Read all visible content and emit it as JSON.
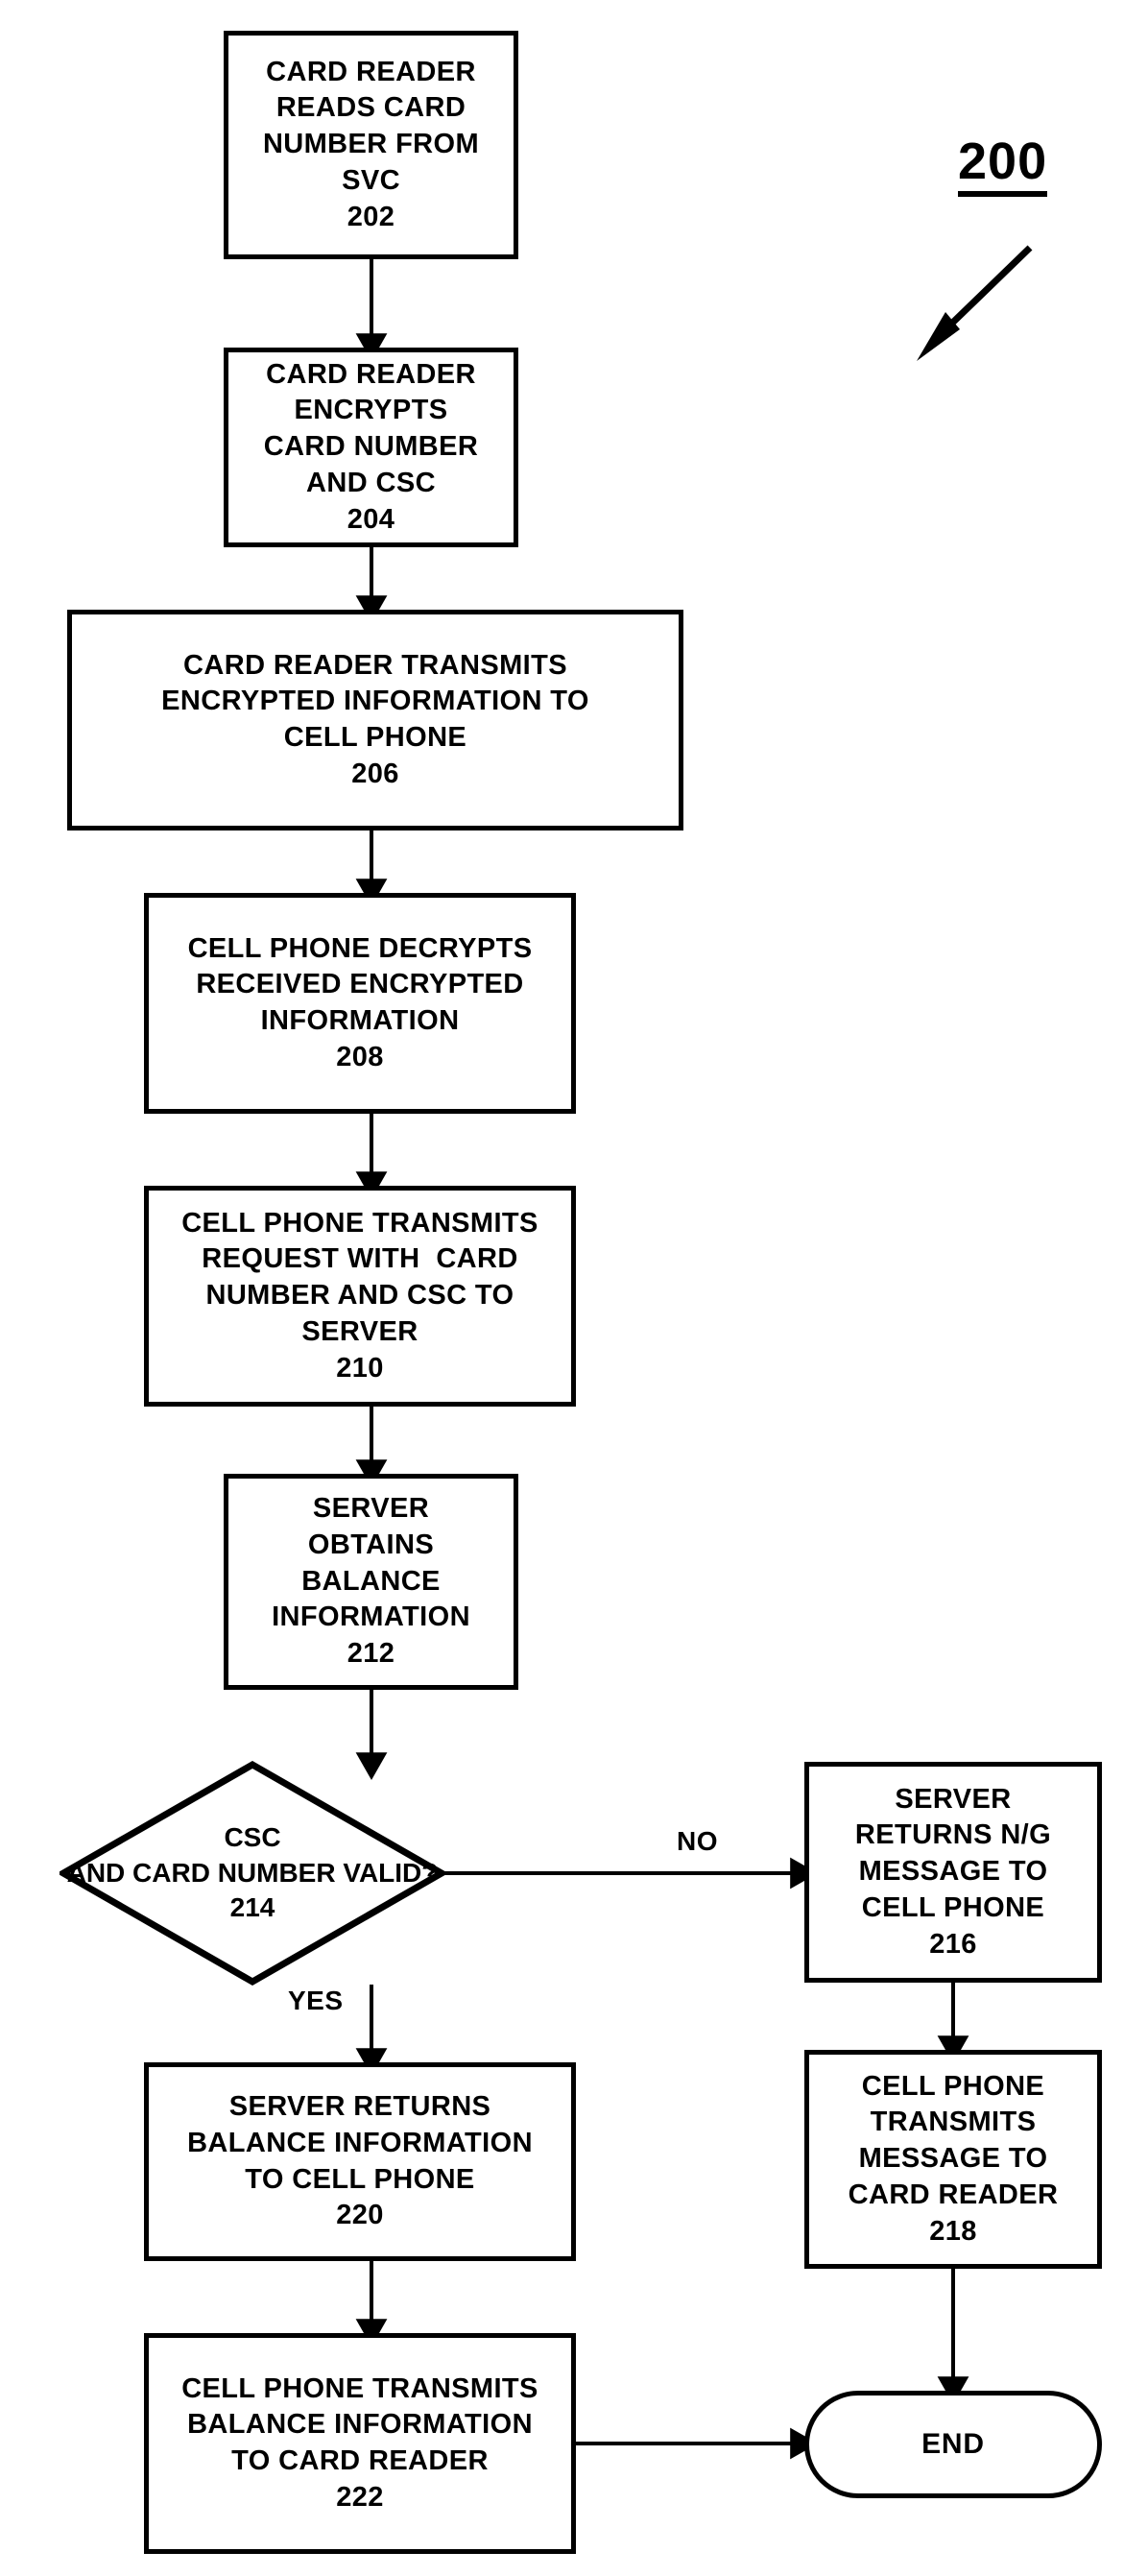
{
  "figure": {
    "number": "200",
    "type": "flowchart"
  },
  "nodes": {
    "n202": {
      "id": "202",
      "shape": "process",
      "lines": [
        "CARD READER",
        "READS CARD",
        "NUMBER FROM",
        "SVC",
        "202"
      ]
    },
    "n204": {
      "id": "204",
      "shape": "process",
      "lines": [
        "CARD READER",
        "ENCRYPTS",
        "CARD NUMBER",
        "AND CSC",
        "204"
      ]
    },
    "n206": {
      "id": "206",
      "shape": "process",
      "lines": [
        "CARD READER TRANSMITS",
        "ENCRYPTED INFORMATION TO",
        "CELL PHONE",
        "206"
      ]
    },
    "n208": {
      "id": "208",
      "shape": "process",
      "lines": [
        "CELL PHONE DECRYPTS",
        "RECEIVED ENCRYPTED",
        "INFORMATION",
        "208"
      ]
    },
    "n210": {
      "id": "210",
      "shape": "process",
      "lines": [
        "CELL PHONE TRANSMITS",
        "REQUEST WITH  CARD",
        "NUMBER AND CSC TO",
        "SERVER",
        "210"
      ]
    },
    "n212": {
      "id": "212",
      "shape": "process",
      "lines": [
        "SERVER",
        "OBTAINS",
        "BALANCE",
        "INFORMATION",
        "212"
      ]
    },
    "n214": {
      "id": "214",
      "shape": "decision",
      "lines": [
        "CSC",
        "AND CARD NUMBER VALID?",
        "214"
      ]
    },
    "n216": {
      "id": "216",
      "shape": "process",
      "lines": [
        "SERVER",
        "RETURNS N/G",
        "MESSAGE TO",
        "CELL PHONE",
        "216"
      ]
    },
    "n218": {
      "id": "218",
      "shape": "process",
      "lines": [
        "CELL PHONE",
        "TRANSMITS",
        "MESSAGE TO",
        "CARD READER",
        "218"
      ]
    },
    "n220": {
      "id": "220",
      "shape": "process",
      "lines": [
        "SERVER RETURNS",
        "BALANCE INFORMATION",
        "TO CELL PHONE",
        "220"
      ]
    },
    "n222": {
      "id": "222",
      "shape": "process",
      "lines": [
        "CELL PHONE TRANSMITS",
        "BALANCE INFORMATION",
        "TO CARD READER",
        "222"
      ]
    },
    "end": {
      "id": "end",
      "shape": "terminator",
      "label": "END"
    }
  },
  "branch_labels": {
    "no": "NO",
    "yes": "YES"
  },
  "edges": [
    {
      "from": "202",
      "to": "204",
      "label": ""
    },
    {
      "from": "204",
      "to": "206",
      "label": ""
    },
    {
      "from": "206",
      "to": "208",
      "label": ""
    },
    {
      "from": "208",
      "to": "210",
      "label": ""
    },
    {
      "from": "210",
      "to": "212",
      "label": ""
    },
    {
      "from": "212",
      "to": "214",
      "label": ""
    },
    {
      "from": "214",
      "to": "216",
      "label": "NO"
    },
    {
      "from": "214",
      "to": "220",
      "label": "YES"
    },
    {
      "from": "216",
      "to": "218",
      "label": ""
    },
    {
      "from": "218",
      "to": "end",
      "label": ""
    },
    {
      "from": "220",
      "to": "222",
      "label": ""
    },
    {
      "from": "222",
      "to": "end",
      "label": ""
    }
  ],
  "colors": {
    "stroke": "#000000",
    "fill": "#ffffff",
    "text": "#000000"
  }
}
